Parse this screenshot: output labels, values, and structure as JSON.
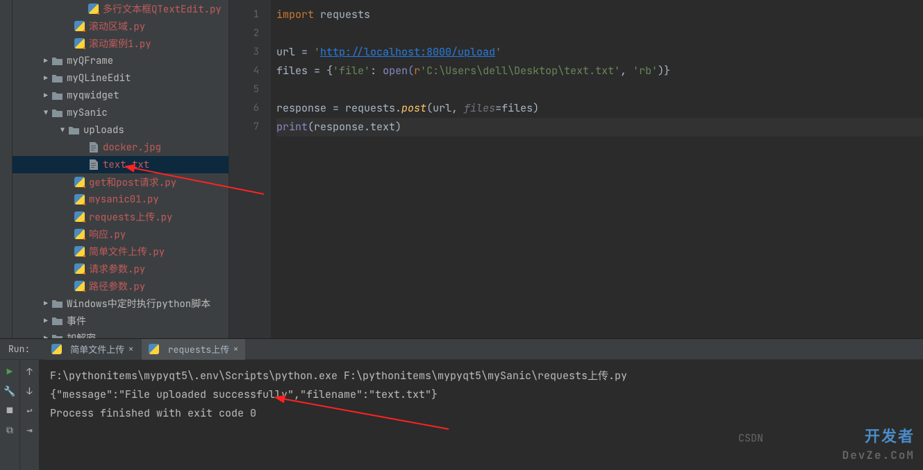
{
  "tree": {
    "items": [
      {
        "label": "多行文本框QTextEdit.py",
        "type": "py",
        "indent": "indent4"
      },
      {
        "label": "滚动区域.py",
        "type": "py",
        "indent": "indent3"
      },
      {
        "label": "滚动案例1.py",
        "type": "py",
        "indent": "indent3"
      },
      {
        "label": "myQFrame",
        "type": "folder",
        "indent": "indent1",
        "chev": "▶",
        "style": "dark"
      },
      {
        "label": "myQLineEdit",
        "type": "folder",
        "indent": "indent1",
        "chev": "▶",
        "style": "dark"
      },
      {
        "label": "myqwidget",
        "type": "folder",
        "indent": "indent1",
        "chev": "▶",
        "style": "dark"
      },
      {
        "label": "mySanic",
        "type": "folder",
        "indent": "indent1",
        "chev": "▼",
        "style": "dark"
      },
      {
        "label": "uploads",
        "type": "folder",
        "indent": "indent2",
        "chev": "▼",
        "style": "dark"
      },
      {
        "label": "docker.jpg",
        "type": "file",
        "indent": "indent4"
      },
      {
        "label": "text.txt",
        "type": "file",
        "indent": "indent4",
        "selected": true
      },
      {
        "label": "get和post请求.py",
        "type": "py",
        "indent": "indent3"
      },
      {
        "label": "mysanic01.py",
        "type": "py",
        "indent": "indent3"
      },
      {
        "label": "requests上传.py",
        "type": "py",
        "indent": "indent3"
      },
      {
        "label": "响应.py",
        "type": "py",
        "indent": "indent3"
      },
      {
        "label": "简单文件上传.py",
        "type": "py",
        "indent": "indent3"
      },
      {
        "label": "请求参数.py",
        "type": "py",
        "indent": "indent3"
      },
      {
        "label": "路径参数.py",
        "type": "py",
        "indent": "indent3"
      },
      {
        "label": "Windows中定时执行python脚本",
        "type": "folder",
        "indent": "indent1",
        "chev": "▶",
        "style": "dark"
      },
      {
        "label": "事件",
        "type": "folder",
        "indent": "indent1",
        "chev": "▶",
        "style": "dark"
      },
      {
        "label": "加解密",
        "type": "folder",
        "indent": "indent1",
        "chev": "▶",
        "style": "dark"
      }
    ]
  },
  "gutter": [
    "1",
    "2",
    "3",
    "4",
    "5",
    "6",
    "7"
  ],
  "code": {
    "l1_kw": "import",
    "l1_mod": "requests",
    "l3_var": "url ",
    "l3_eq": "=",
    "l3_q1": " '",
    "l3_url": "http://localhost:8000/upload",
    "l3_q2": "'",
    "l4_var": "files ",
    "l4_eq": "=",
    "l4_b1": " {",
    "l4_key": "'file'",
    "l4_c": ":",
    "l4_open": " open(",
    "l4_kw": "r",
    "l4_path": "'C:\\Users\\dell\\Desktop\\text.txt'",
    "l4_c2": ", ",
    "l4_mode": "'rb'",
    "l4_b2": ")}",
    "l6_var": "response ",
    "l6_eq": "=",
    "l6_req": " requests.",
    "l6_post": "post",
    "l6_p1": "(url, ",
    "l6_param": "files",
    "l6_p2": "=files)",
    "l7_print": "print",
    "l7_p1": "(response.text",
    "l7_p2": ")"
  },
  "run": {
    "label": "Run:",
    "tab1": "简单文件上传",
    "tab2": "requests上传",
    "line1": "F:\\pythonitems\\mypyqt5\\.env\\Scripts\\python.exe F:\\pythonitems\\mypyqt5\\mySanic\\requests上传.py",
    "line2": "{\"message\":\"File uploaded successfully\",\"filename\":\"text.txt\"}",
    "line3": "",
    "line4": "Process finished with exit code 0"
  },
  "watermark": {
    "csdn": "CSDN",
    "title": "开发者",
    "sub": "DevZe.CoM"
  }
}
